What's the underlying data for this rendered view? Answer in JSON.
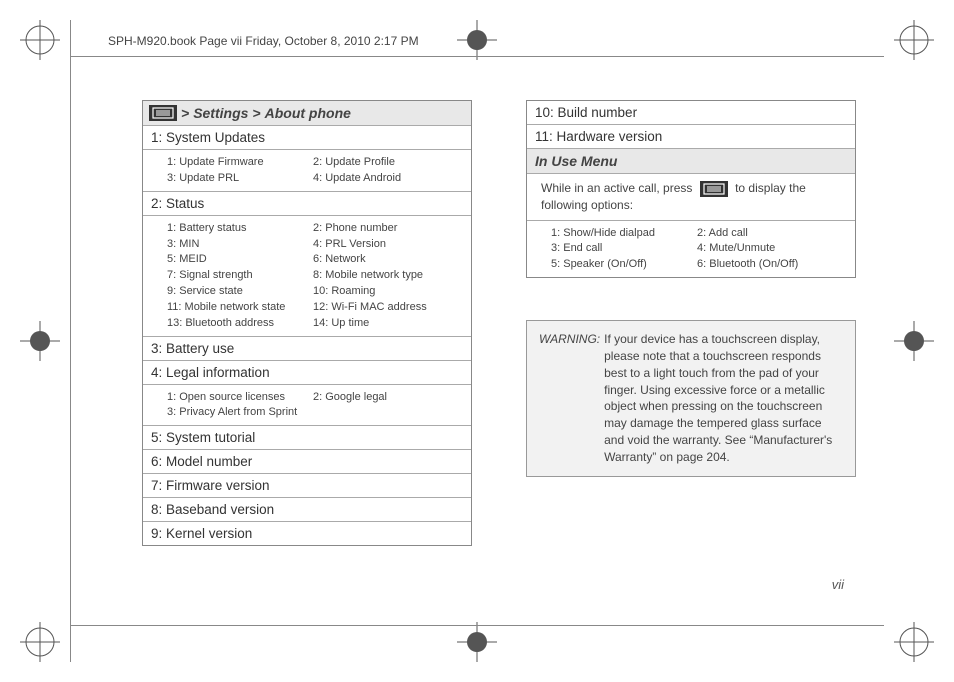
{
  "header_text": "SPH-M920.book  Page vii  Friday, October 8, 2010  2:17 PM",
  "page_number": "vii",
  "nav": {
    "sep": ">",
    "p1": "Settings",
    "p2": "About phone"
  },
  "left": {
    "r1": "1: System Updates",
    "s1": [
      "1: Update Firmware",
      "2: Update Profile",
      "3: Update PRL",
      "4: Update Android"
    ],
    "r2": "2: Status",
    "s2": [
      "1: Battery status",
      "2: Phone number",
      "3: MIN",
      "4: PRL Version",
      "5: MEID",
      "6: Network",
      "7: Signal strength",
      "8: Mobile network type",
      "9: Service state",
      "10: Roaming",
      "11: Mobile network state",
      "12: Wi-Fi MAC address",
      "13: Bluetooth address",
      "14: Up time"
    ],
    "r3": "3: Battery use",
    "r4": "4: Legal information",
    "s4": [
      "1: Open source licenses",
      "2: Google legal",
      "3: Privacy Alert from Sprint",
      ""
    ],
    "r5": "5: System tutorial",
    "r6": "6: Model number",
    "r7": "7: Firmware version",
    "r8": "8: Baseband version",
    "r9": "9: Kernel version"
  },
  "right": {
    "r10": "10: Build number",
    "r11": "11: Hardware version",
    "inuse_title": "In Use Menu",
    "inuse_text_a": "While in an active call, press",
    "inuse_text_b": "to display the following options:",
    "inuse_sub": [
      "1: Show/Hide dialpad",
      "2: Add call",
      "3: End call",
      "4: Mute/Unmute",
      "5: Speaker (On/Off)",
      "6: Bluetooth (On/Off)"
    ]
  },
  "warning": {
    "label": "WARNING:",
    "text": "If your device has a touchscreen display, please note that a touchscreen responds best to a light touch from the pad of your finger. Using excessive force or a metallic object when pressing on the touchscreen may damage the tempered glass surface and void the warranty. See “Manufacturer's Warranty” on page 204."
  }
}
